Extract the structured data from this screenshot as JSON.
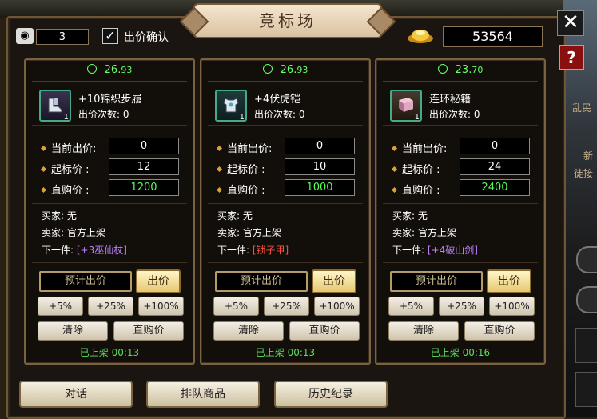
{
  "window": {
    "title": "竞标场",
    "close_glyph": "✕",
    "help_glyph": "?"
  },
  "topbar": {
    "watch_count": "3",
    "confirm_checked": true,
    "confirm_label": "出价确认",
    "gold": "53564"
  },
  "cards": [
    {
      "timer_main": "26.",
      "timer_dec": "93",
      "item_name": "+10锦织步履",
      "item_qty": "1",
      "bid_count_label": "出价次数: 0",
      "current_label": "当前出价:",
      "current_value": "0",
      "start_label": "起标价  :",
      "start_value": "12",
      "buyout_label": "直购价  :",
      "buyout_value": "1200",
      "buyer": "买家: 无",
      "seller": "卖家: 官方上架",
      "next_label": "下一件: ",
      "next_item": "[+3巫仙杖]",
      "est_bid": "预计出价",
      "bid_button": "出价",
      "pct5": "+5%",
      "pct25": "+25%",
      "pct100": "+100%",
      "clear": "清除",
      "buyout_button": "直购价",
      "listed": "已上架 00:13"
    },
    {
      "timer_main": "26.",
      "timer_dec": "93",
      "item_name": "+4伏虎铠",
      "item_qty": "1",
      "bid_count_label": "出价次数: 0",
      "current_label": "当前出价:",
      "current_value": "0",
      "start_label": "起标价  :",
      "start_value": "10",
      "buyout_label": "直购价  :",
      "buyout_value": "1000",
      "buyer": "买家: 无",
      "seller": "卖家: 官方上架",
      "next_label": "下一件: ",
      "next_item": "[锁子甲]",
      "est_bid": "预计出价",
      "bid_button": "出价",
      "pct5": "+5%",
      "pct25": "+25%",
      "pct100": "+100%",
      "clear": "清除",
      "buyout_button": "直购价",
      "listed": "已上架 00:13"
    },
    {
      "timer_main": "23.",
      "timer_dec": "70",
      "item_name": "连环秘籍",
      "item_qty": "1",
      "bid_count_label": "出价次数: 0",
      "current_label": "当前出价:",
      "current_value": "0",
      "start_label": "起标价  :",
      "start_value": "24",
      "buyout_label": "直购价  :",
      "buyout_value": "2400",
      "buyer": "买家: 无",
      "seller": "卖家: 官方上架",
      "next_label": "下一件: ",
      "next_item": "[+4破山剑]",
      "est_bid": "预计出价",
      "bid_button": "出价",
      "pct5": "+5%",
      "pct25": "+25%",
      "pct100": "+100%",
      "clear": "清除",
      "buyout_button": "直购价",
      "listed": "已上架 00:16"
    }
  ],
  "bottom": {
    "chat": "对话",
    "queue": "排队商品",
    "history": "历史纪录"
  },
  "side": {
    "text1": "乱民",
    "text2": "新",
    "text3": "徒接"
  },
  "colors": {
    "timer_green": "#66ff66",
    "next_purple": "#c080ff",
    "next_red": "#ff5040",
    "buyout_green": "#55ff55"
  }
}
